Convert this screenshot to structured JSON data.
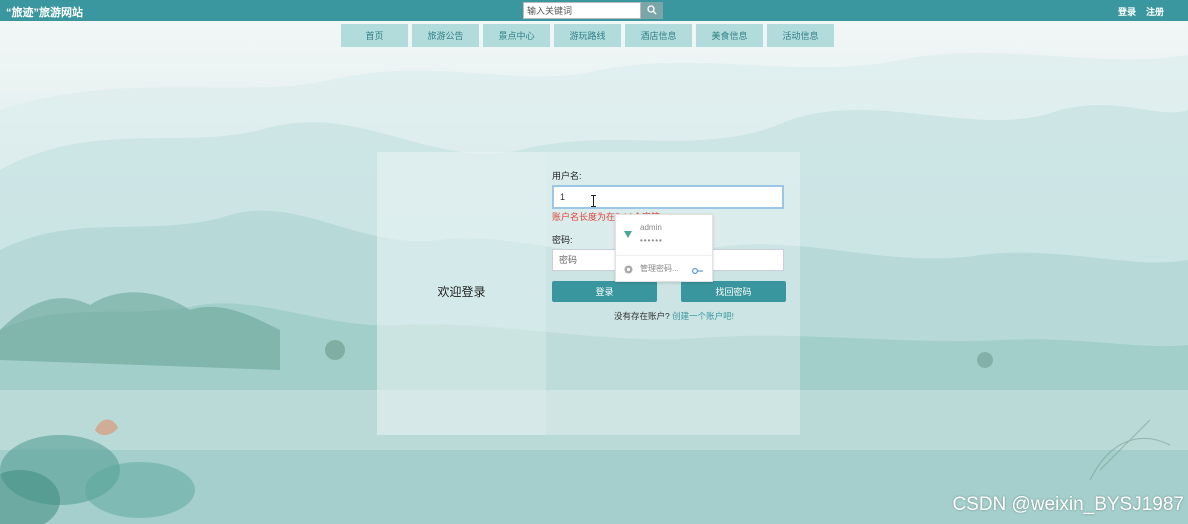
{
  "header": {
    "site_title": "“旅迹”旅游网站",
    "search_placeholder": "输入关键词",
    "login_link": "登录",
    "register_link": "注册"
  },
  "nav": {
    "items": [
      {
        "label": "首页"
      },
      {
        "label": "旅游公告"
      },
      {
        "label": "景点中心"
      },
      {
        "label": "游玩路线"
      },
      {
        "label": "酒店信息"
      },
      {
        "label": "美食信息"
      },
      {
        "label": "活动信息"
      }
    ]
  },
  "login": {
    "welcome": "欢迎登录",
    "username_label": "用户名:",
    "username_value": "1",
    "username_error": "账户名长度为在5-16个字符",
    "password_label": "密码:",
    "password_placeholder": "密码",
    "login_button": "登录",
    "recover_button": "找回密码",
    "no_account_text": "没有存在账户?",
    "create_link": "创建一个账户吧!"
  },
  "autofill": {
    "username": "admin",
    "password_mask": "••••••",
    "manage_label": "管理密码..."
  },
  "watermark": "CSDN @weixin_BYSJ1987",
  "colors": {
    "primary": "#3a979f",
    "nav_bg": "#b2dcdc",
    "error": "#e0433a"
  }
}
